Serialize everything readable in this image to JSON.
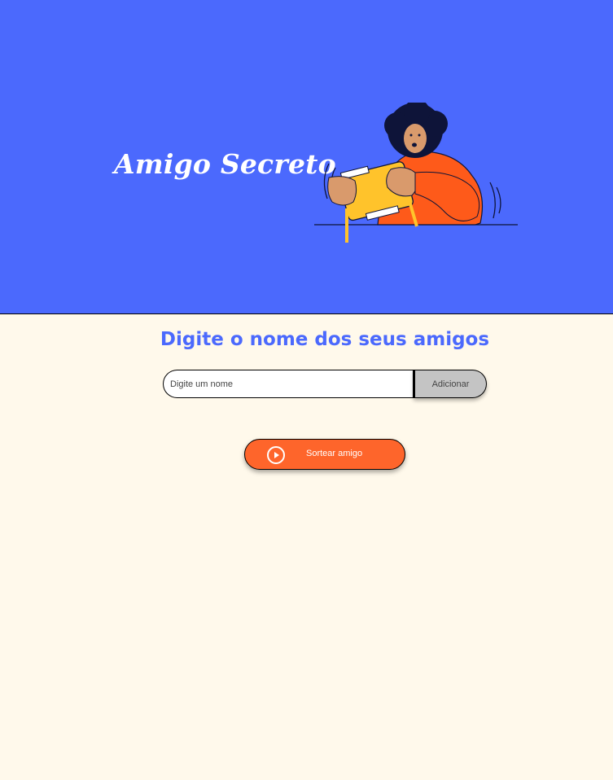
{
  "header": {
    "title": "Amigo Secreto",
    "background_color": "#4B69FD",
    "illustration": "person-opening-gift-illustration"
  },
  "main": {
    "section_title": "Digite o nome dos seus amigos",
    "name_input": {
      "placeholder": "Digite um nome",
      "value": ""
    },
    "add_button_label": "Adicionar",
    "draw_button": {
      "label": "Sortear amigo",
      "icon": "play-circle-icon",
      "color": "#FE652B"
    },
    "page_background": "#FFF9EB",
    "accent_color": "#4B69FD"
  }
}
